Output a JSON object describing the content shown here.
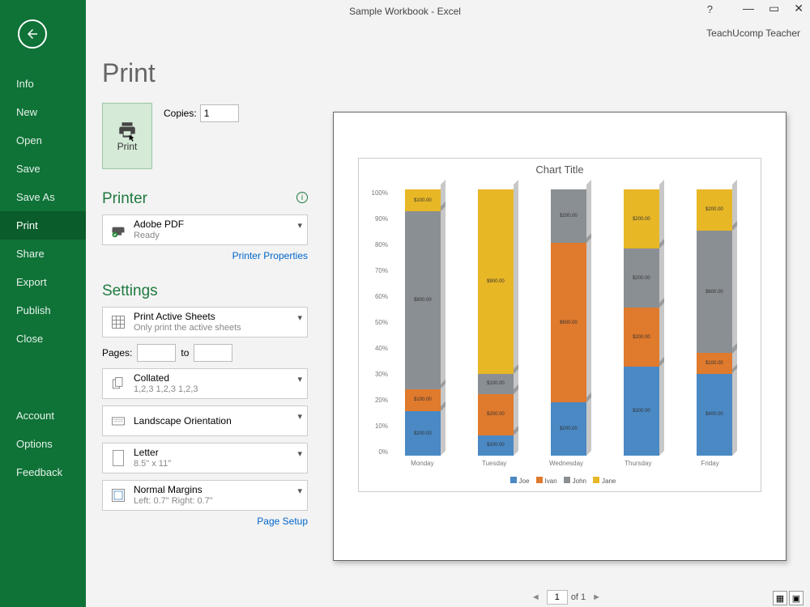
{
  "window": {
    "title": "Sample Workbook - Excel",
    "user": "TeachUcomp Teacher"
  },
  "sidebar": {
    "items": [
      "Info",
      "New",
      "Open",
      "Save",
      "Save As",
      "Print",
      "Share",
      "Export",
      "Publish",
      "Close"
    ],
    "extra": [
      "Account",
      "Options",
      "Feedback"
    ],
    "selected": 5
  },
  "print": {
    "heading": "Print",
    "button_label": "Print",
    "copies_label": "Copies:",
    "copies_value": "1",
    "printer_heading": "Printer",
    "printer_name": "Adobe PDF",
    "printer_status": "Ready",
    "printer_props": "Printer Properties",
    "settings_heading": "Settings",
    "setting1_title": "Print Active Sheets",
    "setting1_sub": "Only print the active sheets",
    "pages_label": "Pages:",
    "pages_to": "to",
    "collated_title": "Collated",
    "collated_sub": "1,2,3    1,2,3    1,2,3",
    "orientation": "Landscape Orientation",
    "paper_title": "Letter",
    "paper_sub": "8.5\" x 11\"",
    "margins_title": "Normal Margins",
    "margins_sub": "Left:  0.7\"    Right:  0.7\"",
    "page_setup": "Page Setup"
  },
  "preview": {
    "page_input": "1",
    "page_of": "of 1"
  },
  "chart_data": {
    "type": "bar",
    "title": "Chart Title",
    "ylabel": "",
    "ylim": [
      0,
      100
    ],
    "yticks": [
      "100%",
      "90%",
      "80%",
      "70%",
      "60%",
      "50%",
      "40%",
      "30%",
      "20%",
      "10%",
      "0%"
    ],
    "categories": [
      "Monday",
      "Tuesday",
      "Wednesday",
      "Thursday",
      "Friday"
    ],
    "series": [
      {
        "name": "Joe",
        "color": "#4a89c4",
        "values": [
          200,
          100,
          200,
          300,
          400
        ],
        "labels": [
          "$200.00",
          "$100.00",
          "$200.00",
          "$300.00",
          "$400.00"
        ]
      },
      {
        "name": "Ivan",
        "color": "#e07a2d",
        "values": [
          100,
          200,
          600,
          200,
          100
        ],
        "labels": [
          "$100.00",
          "$200.00",
          "$600.00",
          "$200.00",
          "$100.00"
        ]
      },
      {
        "name": "John",
        "color": "#8a8f94",
        "values": [
          800,
          100,
          200,
          200,
          600
        ],
        "labels": [
          "$800.00",
          "$100.00",
          "$200.00",
          "$200.00",
          "$600.00"
        ]
      },
      {
        "name": "Jane",
        "color": "#e8b726",
        "values": [
          100,
          900,
          0,
          200,
          200
        ],
        "labels": [
          "$100.00",
          "$900.00",
          "",
          "$200.00",
          "$200.00"
        ]
      }
    ]
  }
}
